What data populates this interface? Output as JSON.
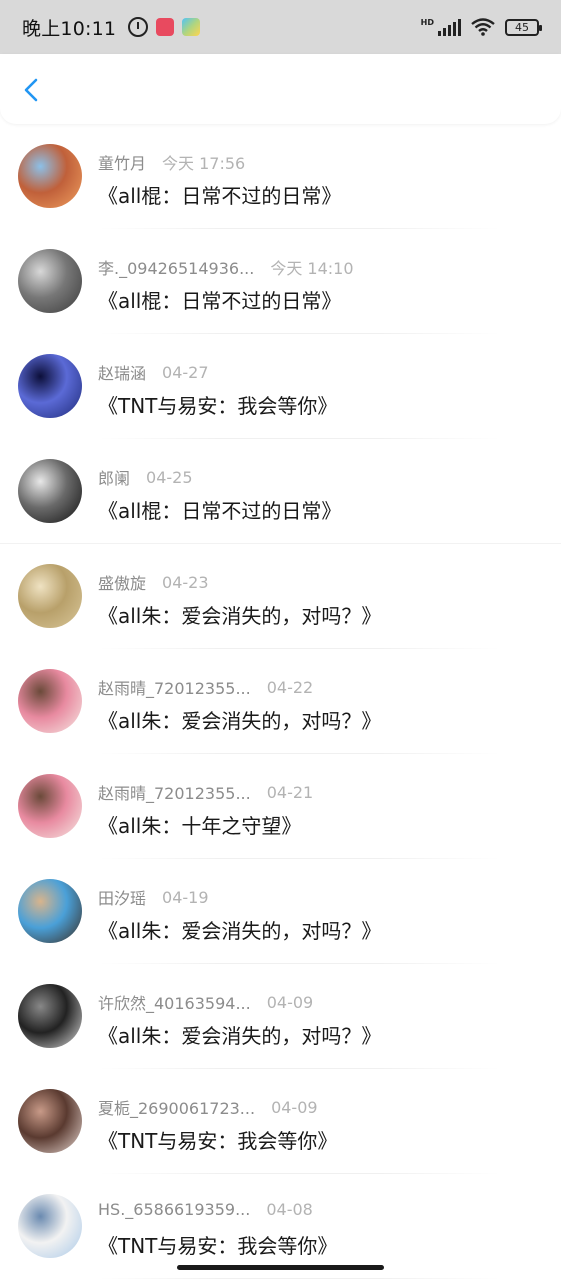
{
  "status_bar": {
    "time": "晚上10:11",
    "battery": "45",
    "network_label": "HD"
  },
  "header": {
    "back_icon": "chevron-left-icon",
    "accent_color": "#2196f3"
  },
  "items": [
    {
      "name": "童竹月",
      "date": "今天 17:56",
      "title": "《all棍：日常不过的日常》",
      "avatar_colors": [
        "#f0a060",
        "#c0603a",
        "#8cc0e8"
      ]
    },
    {
      "name": "李._09426514936...",
      "date": "今天 14:10",
      "title": "《all棍：日常不过的日常》",
      "avatar_colors": [
        "#3a3a3a",
        "#777777",
        "#d8d8d8"
      ]
    },
    {
      "name": "赵瑞涵",
      "date": "04-27",
      "title": "《TNT与易安：我会等你》",
      "avatar_colors": [
        "#1e2a78",
        "#5b6ad6",
        "#0c0f3a"
      ]
    },
    {
      "name": "郎阑",
      "date": "04-25",
      "title": "《all棍：日常不过的日常》",
      "avatar_colors": [
        "#111111",
        "#6a6a6a",
        "#e8e8e8"
      ]
    },
    {
      "name": "盛傲旋",
      "date": "04-23",
      "title": "《all朱：爱会消失的，对吗？》",
      "avatar_colors": [
        "#d9c79a",
        "#b8a06a",
        "#efe2c2"
      ]
    },
    {
      "name": "赵雨晴_72012355...",
      "date": "04-22",
      "title": "《all朱：爱会消失的，对吗？》",
      "avatar_colors": [
        "#f6e9e4",
        "#e88aa0",
        "#6b4a3a"
      ]
    },
    {
      "name": "赵雨晴_72012355...",
      "date": "04-21",
      "title": "《all朱：十年之守望》",
      "avatar_colors": [
        "#f6e9e4",
        "#e88aa0",
        "#6b4a3a"
      ]
    },
    {
      "name": "田汐瑶",
      "date": "04-19",
      "title": "《all朱：爱会消失的，对吗？》",
      "avatar_colors": [
        "#3a2a1e",
        "#4aa0d8",
        "#d8b48c"
      ]
    },
    {
      "name": "许欣然_40163594...",
      "date": "04-09",
      "title": "《all朱：爱会消失的，对吗？》",
      "avatar_colors": [
        "#dddddd",
        "#222222",
        "#888888"
      ]
    },
    {
      "name": "夏栀_2690061723...",
      "date": "04-09",
      "title": "《TNT与易安：我会等你》",
      "avatar_colors": [
        "#e8d8d2",
        "#5a3a30",
        "#c89a88"
      ]
    },
    {
      "name": "HS._6586619359...",
      "date": "04-08",
      "title": "《TNT与易安：我会等你》",
      "avatar_colors": [
        "#a8c8e8",
        "#f2f2f2",
        "#6a8ab0"
      ]
    }
  ]
}
